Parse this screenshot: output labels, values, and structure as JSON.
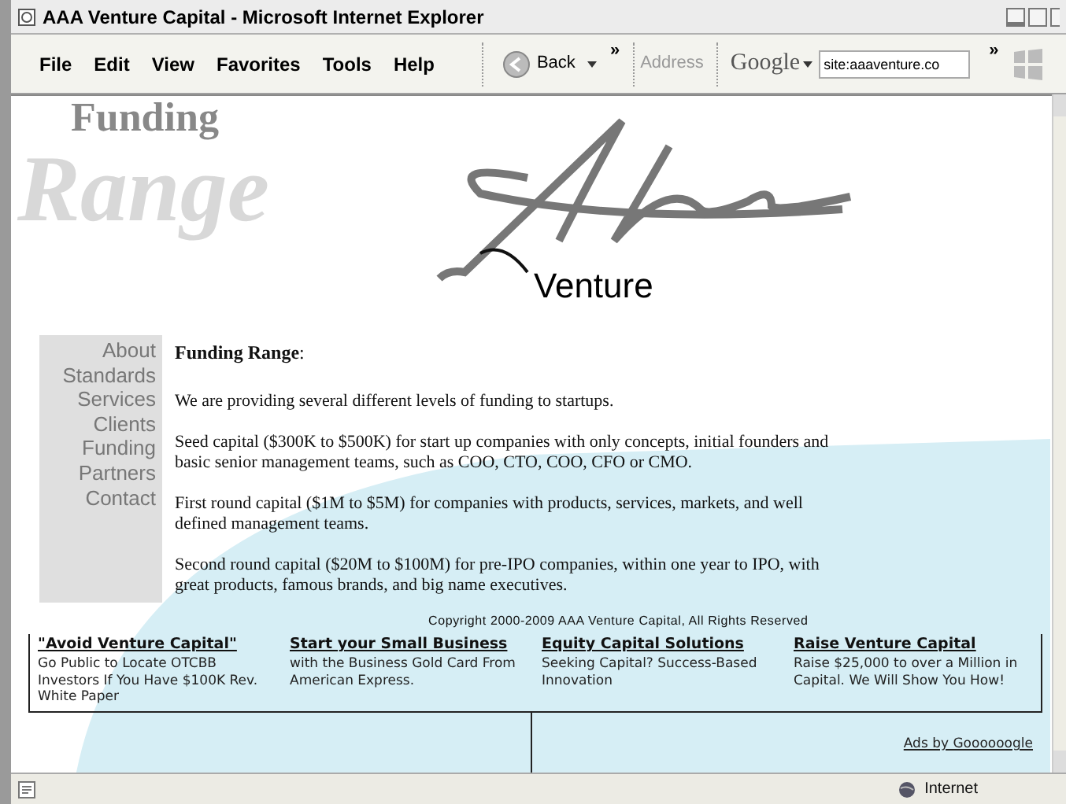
{
  "window": {
    "title": "AAA Venture Capital - Microsoft Internet Explorer"
  },
  "menu": {
    "items": [
      "File",
      "Edit",
      "View",
      "Favorites",
      "Tools",
      "Help"
    ]
  },
  "toolbar": {
    "back": "Back",
    "chevron_1": "»",
    "address_label": "Address",
    "google_label": "Google",
    "search_value": "site:aaaventure.co",
    "chevron_2": "»"
  },
  "header": {
    "funding": "Funding",
    "range": "Range",
    "logo_text": "Venture"
  },
  "nav": {
    "items": [
      "About",
      "Standards",
      "Services",
      "Clients",
      "Funding",
      "Partners",
      "Contact"
    ]
  },
  "content": {
    "heading": "**Funding Range**:",
    "paragraphs": [
      "We are providing several different levels of funding to startups.",
      "Seed capital ($300K to $500K) for start up companies with only concepts, initial founders and basic senior management teams, such as COO, CTO, COO, CFO or CMO.",
      "First round capital ($1M to $5M) for companies with products, services, markets, and well defined management teams.",
      "Second round capital ($20M to $100M) for pre-IPO companies, within one year to IPO, with great products, famous brands, and big name executives."
    ]
  },
  "copyright": "Copyright 2000-2009 AAA Venture Capital, All Rights Reserved",
  "ads": [
    {
      "title": "\"Avoid Venture Capital\"",
      "body": "Go Public to Locate OTCBB Investors If You Have $100K Rev. White Paper"
    },
    {
      "title": "Start your Small Business",
      "body": "with the Business Gold Card From American Express."
    },
    {
      "title": "Equity Capital Solutions",
      "body": "Seeking Capital? Success-Based Innovation"
    },
    {
      "title": "Raise Venture Capital",
      "body": "Raise $25,000 to over a Million in Capital. We Will Show You How!"
    }
  ],
  "ads_by": "Ads by Goooooogle",
  "status_bar": {
    "zone": "Internet"
  }
}
